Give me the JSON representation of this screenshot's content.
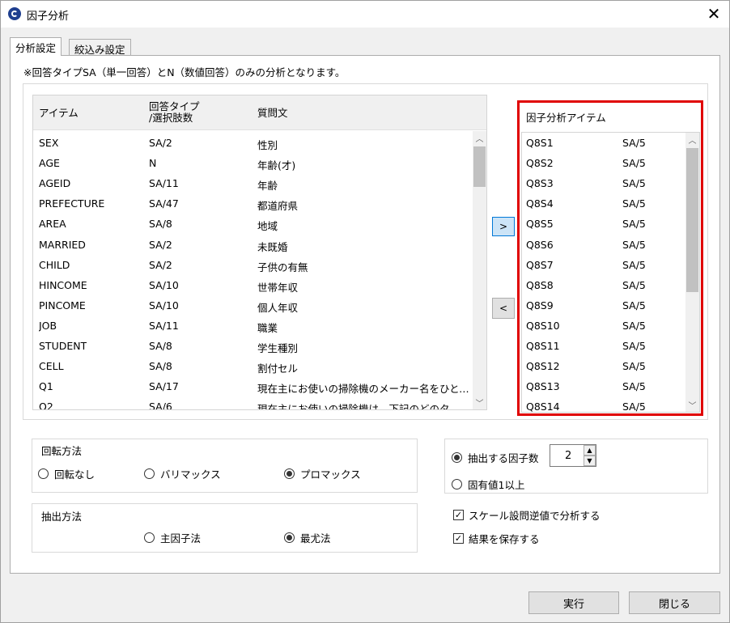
{
  "window": {
    "title": "因子分析",
    "close_glyph": "✕"
  },
  "tabs": [
    {
      "label": "分析設定",
      "active": true
    },
    {
      "label": "絞込み設定",
      "active": false
    }
  ],
  "note": "※回答タイプSA（単一回答）とN（数値回答）のみの分析となります。",
  "item_table": {
    "columns": [
      "アイテム",
      "回答タイプ",
      "/選択肢数",
      "質問文"
    ],
    "rows": [
      {
        "item": "SEX",
        "type": "SA/2",
        "question": "性別"
      },
      {
        "item": "AGE",
        "type": "N",
        "question": "年齢(才)"
      },
      {
        "item": "AGEID",
        "type": "SA/11",
        "question": "年齢"
      },
      {
        "item": "PREFECTURE",
        "type": "SA/47",
        "question": "都道府県"
      },
      {
        "item": "AREA",
        "type": "SA/8",
        "question": "地域"
      },
      {
        "item": "MARRIED",
        "type": "SA/2",
        "question": "未既婚"
      },
      {
        "item": "CHILD",
        "type": "SA/2",
        "question": "子供の有無"
      },
      {
        "item": "HINCOME",
        "type": "SA/10",
        "question": "世帯年収"
      },
      {
        "item": "PINCOME",
        "type": "SA/10",
        "question": "個人年収"
      },
      {
        "item": "JOB",
        "type": "SA/11",
        "question": "職業"
      },
      {
        "item": "STUDENT",
        "type": "SA/8",
        "question": "学生種別"
      },
      {
        "item": "CELL",
        "type": "SA/8",
        "question": "割付セル"
      },
      {
        "item": "Q1",
        "type": "SA/17",
        "question": "現在主にお使いの掃除機のメーカー名をひとつ..."
      },
      {
        "item": "Q2",
        "type": "SA/6",
        "question": "現在主にお使いの掃除機は、下記のどのタイプ..."
      }
    ]
  },
  "buttons": {
    "move_right": ">",
    "move_left": "<",
    "run": "実行",
    "close": "閉じる"
  },
  "factor_items": {
    "header": "因子分析アイテム",
    "rows": [
      {
        "item": "Q8S1",
        "type": "SA/5"
      },
      {
        "item": "Q8S2",
        "type": "SA/5"
      },
      {
        "item": "Q8S3",
        "type": "SA/5"
      },
      {
        "item": "Q8S4",
        "type": "SA/5"
      },
      {
        "item": "Q8S5",
        "type": "SA/5"
      },
      {
        "item": "Q8S6",
        "type": "SA/5"
      },
      {
        "item": "Q8S7",
        "type": "SA/5"
      },
      {
        "item": "Q8S8",
        "type": "SA/5"
      },
      {
        "item": "Q8S9",
        "type": "SA/5"
      },
      {
        "item": "Q8S10",
        "type": "SA/5"
      },
      {
        "item": "Q8S11",
        "type": "SA/5"
      },
      {
        "item": "Q8S12",
        "type": "SA/5"
      },
      {
        "item": "Q8S13",
        "type": "SA/5"
      },
      {
        "item": "Q8S14",
        "type": "SA/5"
      }
    ]
  },
  "rotation": {
    "title": "回転方法",
    "options": [
      "回転なし",
      "バリマックス",
      "プロマックス"
    ],
    "selected": "プロマックス"
  },
  "extraction": {
    "title": "抽出方法",
    "options": [
      "主因子法",
      "最尤法"
    ],
    "selected": "最尤法"
  },
  "factor_count": {
    "option_count_label": "抽出する因子数",
    "option_eigen_label": "固有値1以上",
    "selected": "抽出する因子数",
    "value": "2"
  },
  "checkboxes": [
    {
      "label": "スケール設問逆値で分析する",
      "checked": true
    },
    {
      "label": "結果を保存する",
      "checked": true
    }
  ],
  "colors": {
    "highlight_border": "#e00000",
    "selected_button": "#cce4f7",
    "accent": "#0078d7"
  }
}
